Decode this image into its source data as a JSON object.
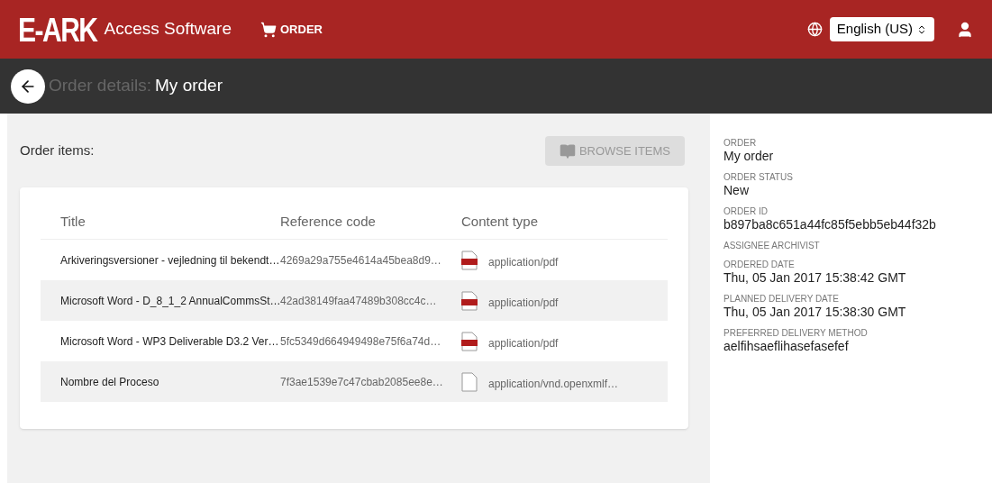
{
  "header": {
    "logo": "E-ARK",
    "app_name": "Access Software",
    "nav": [
      {
        "label": "ORDER"
      }
    ],
    "language": "English (US)"
  },
  "subheader": {
    "prefix": "Order details:",
    "title": "My order"
  },
  "order_items": {
    "label": "Order items:",
    "browse_button": {
      "label": "BROWSE ITEMS",
      "disabled": true
    },
    "table": {
      "columns": [
        "Title",
        "Reference code",
        "Content type"
      ],
      "rows": [
        {
          "title": "Arkiveringsversioner - vejledning til bekendt…",
          "reference_code": "4269a29a755e4614a45bea8d9…",
          "kind": "pdf",
          "content_type": "application/pdf"
        },
        {
          "title": "Microsoft Word - D_8_1_2 AnnualCommsSt…",
          "reference_code": "42ad38149faa47489b308cc4c…",
          "kind": "pdf",
          "content_type": "application/pdf"
        },
        {
          "title": "Microsoft Word - WP3 Deliverable D3.2 Ver…",
          "reference_code": "5fc5349d664949498e75f6a74d…",
          "kind": "pdf",
          "content_type": "application/pdf"
        },
        {
          "title": "Nombre del Proceso",
          "reference_code": "7f3ae1539e7c47cbab2085ee8e…",
          "kind": "file",
          "content_type": "application/vnd.openxmlf…"
        }
      ]
    }
  },
  "details": [
    {
      "label": "ORDER",
      "value": "My order"
    },
    {
      "label": "ORDER STATUS",
      "value": "New"
    },
    {
      "label": "ORDER ID",
      "value": "b897ba8c651a44fc85f5ebb5eb44f32b"
    },
    {
      "label": "ASSIGNEE ARCHIVIST"
    },
    {
      "label": "ORDERED DATE",
      "value": "Thu, 05 Jan 2017 15:38:42 GMT"
    },
    {
      "label": "PLANNED DELIVERY DATE",
      "value": "Thu, 05 Jan 2017 15:38:30 GMT"
    },
    {
      "label": "PREFERRED DELIVERY METHOD",
      "value": "aelfihsaeflihasefasefef"
    }
  ]
}
